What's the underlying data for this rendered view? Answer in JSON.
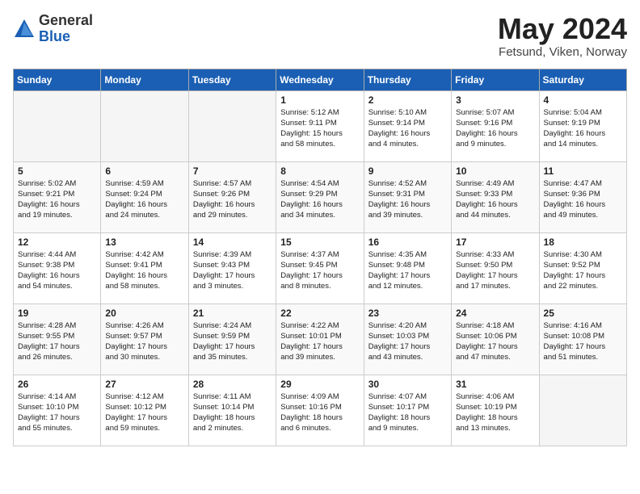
{
  "logo": {
    "general": "General",
    "blue": "Blue"
  },
  "title": "May 2024",
  "location": "Fetsund, Viken, Norway",
  "weekdays": [
    "Sunday",
    "Monday",
    "Tuesday",
    "Wednesday",
    "Thursday",
    "Friday",
    "Saturday"
  ],
  "weeks": [
    [
      {
        "day": "",
        "info": ""
      },
      {
        "day": "",
        "info": ""
      },
      {
        "day": "",
        "info": ""
      },
      {
        "day": "1",
        "info": "Sunrise: 5:12 AM\nSunset: 9:11 PM\nDaylight: 15 hours\nand 58 minutes."
      },
      {
        "day": "2",
        "info": "Sunrise: 5:10 AM\nSunset: 9:14 PM\nDaylight: 16 hours\nand 4 minutes."
      },
      {
        "day": "3",
        "info": "Sunrise: 5:07 AM\nSunset: 9:16 PM\nDaylight: 16 hours\nand 9 minutes."
      },
      {
        "day": "4",
        "info": "Sunrise: 5:04 AM\nSunset: 9:19 PM\nDaylight: 16 hours\nand 14 minutes."
      }
    ],
    [
      {
        "day": "5",
        "info": "Sunrise: 5:02 AM\nSunset: 9:21 PM\nDaylight: 16 hours\nand 19 minutes."
      },
      {
        "day": "6",
        "info": "Sunrise: 4:59 AM\nSunset: 9:24 PM\nDaylight: 16 hours\nand 24 minutes."
      },
      {
        "day": "7",
        "info": "Sunrise: 4:57 AM\nSunset: 9:26 PM\nDaylight: 16 hours\nand 29 minutes."
      },
      {
        "day": "8",
        "info": "Sunrise: 4:54 AM\nSunset: 9:29 PM\nDaylight: 16 hours\nand 34 minutes."
      },
      {
        "day": "9",
        "info": "Sunrise: 4:52 AM\nSunset: 9:31 PM\nDaylight: 16 hours\nand 39 minutes."
      },
      {
        "day": "10",
        "info": "Sunrise: 4:49 AM\nSunset: 9:33 PM\nDaylight: 16 hours\nand 44 minutes."
      },
      {
        "day": "11",
        "info": "Sunrise: 4:47 AM\nSunset: 9:36 PM\nDaylight: 16 hours\nand 49 minutes."
      }
    ],
    [
      {
        "day": "12",
        "info": "Sunrise: 4:44 AM\nSunset: 9:38 PM\nDaylight: 16 hours\nand 54 minutes."
      },
      {
        "day": "13",
        "info": "Sunrise: 4:42 AM\nSunset: 9:41 PM\nDaylight: 16 hours\nand 58 minutes."
      },
      {
        "day": "14",
        "info": "Sunrise: 4:39 AM\nSunset: 9:43 PM\nDaylight: 17 hours\nand 3 minutes."
      },
      {
        "day": "15",
        "info": "Sunrise: 4:37 AM\nSunset: 9:45 PM\nDaylight: 17 hours\nand 8 minutes."
      },
      {
        "day": "16",
        "info": "Sunrise: 4:35 AM\nSunset: 9:48 PM\nDaylight: 17 hours\nand 12 minutes."
      },
      {
        "day": "17",
        "info": "Sunrise: 4:33 AM\nSunset: 9:50 PM\nDaylight: 17 hours\nand 17 minutes."
      },
      {
        "day": "18",
        "info": "Sunrise: 4:30 AM\nSunset: 9:52 PM\nDaylight: 17 hours\nand 22 minutes."
      }
    ],
    [
      {
        "day": "19",
        "info": "Sunrise: 4:28 AM\nSunset: 9:55 PM\nDaylight: 17 hours\nand 26 minutes."
      },
      {
        "day": "20",
        "info": "Sunrise: 4:26 AM\nSunset: 9:57 PM\nDaylight: 17 hours\nand 30 minutes."
      },
      {
        "day": "21",
        "info": "Sunrise: 4:24 AM\nSunset: 9:59 PM\nDaylight: 17 hours\nand 35 minutes."
      },
      {
        "day": "22",
        "info": "Sunrise: 4:22 AM\nSunset: 10:01 PM\nDaylight: 17 hours\nand 39 minutes."
      },
      {
        "day": "23",
        "info": "Sunrise: 4:20 AM\nSunset: 10:03 PM\nDaylight: 17 hours\nand 43 minutes."
      },
      {
        "day": "24",
        "info": "Sunrise: 4:18 AM\nSunset: 10:06 PM\nDaylight: 17 hours\nand 47 minutes."
      },
      {
        "day": "25",
        "info": "Sunrise: 4:16 AM\nSunset: 10:08 PM\nDaylight: 17 hours\nand 51 minutes."
      }
    ],
    [
      {
        "day": "26",
        "info": "Sunrise: 4:14 AM\nSunset: 10:10 PM\nDaylight: 17 hours\nand 55 minutes."
      },
      {
        "day": "27",
        "info": "Sunrise: 4:12 AM\nSunset: 10:12 PM\nDaylight: 17 hours\nand 59 minutes."
      },
      {
        "day": "28",
        "info": "Sunrise: 4:11 AM\nSunset: 10:14 PM\nDaylight: 18 hours\nand 2 minutes."
      },
      {
        "day": "29",
        "info": "Sunrise: 4:09 AM\nSunset: 10:16 PM\nDaylight: 18 hours\nand 6 minutes."
      },
      {
        "day": "30",
        "info": "Sunrise: 4:07 AM\nSunset: 10:17 PM\nDaylight: 18 hours\nand 9 minutes."
      },
      {
        "day": "31",
        "info": "Sunrise: 4:06 AM\nSunset: 10:19 PM\nDaylight: 18 hours\nand 13 minutes."
      },
      {
        "day": "",
        "info": ""
      }
    ]
  ]
}
